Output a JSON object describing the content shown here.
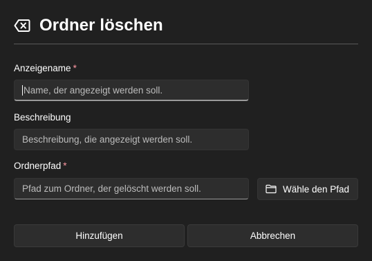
{
  "header": {
    "title": "Ordner löschen",
    "icon": "backspace-icon"
  },
  "form": {
    "display_name": {
      "label": "Anzeigename",
      "required_marker": "*",
      "placeholder": "Name, der angezeigt werden soll."
    },
    "description": {
      "label": "Beschreibung",
      "placeholder": "Beschreibung, die angezeigt werden soll."
    },
    "folder_path": {
      "label": "Ordnerpfad",
      "required_marker": "*",
      "placeholder": "Pfad zum Ordner, der gelöscht werden soll.",
      "browse_label": "Wähle den Pfad",
      "browse_icon": "folder-icon"
    }
  },
  "actions": {
    "add_label": "Hinzufügen",
    "cancel_label": "Abbrechen"
  },
  "colors": {
    "background": "#202020",
    "field_background": "#2d2d2d",
    "required": "#ff99a4",
    "divider": "#5a5a5a"
  }
}
